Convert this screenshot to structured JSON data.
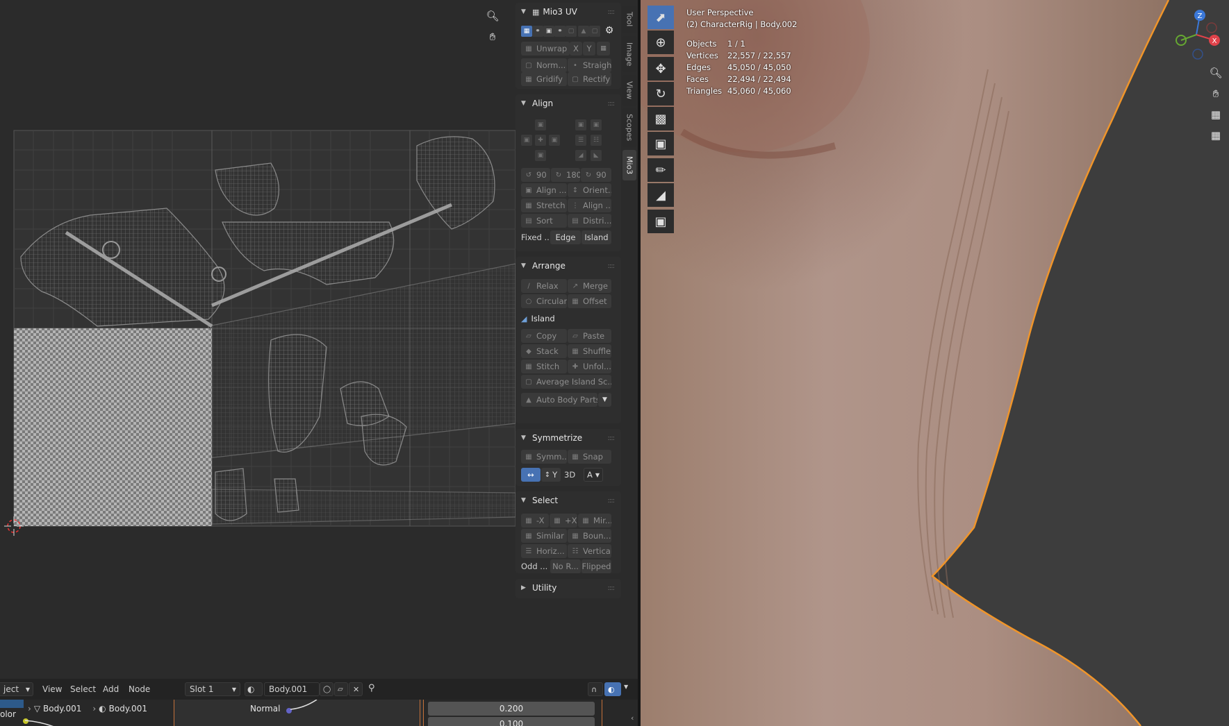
{
  "uv_editor": {
    "nav": {
      "zoom_icon": "zoom-in-icon",
      "pan_icon": "hand-pan-icon"
    }
  },
  "sidebar": {
    "tabs": [
      "Tool",
      "Image",
      "View",
      "Scopes",
      "Mio3"
    ],
    "active_tab": "Mio3",
    "mio3uv": {
      "title": "Mio3 UV",
      "unwrap": "Unwrap",
      "x": "X",
      "y": "Y",
      "norm": "Norm...",
      "straight": "Straight",
      "gridify": "Gridify",
      "rectify": "Rectify"
    },
    "align": {
      "title": "Align",
      "rot1": "90",
      "rot2": "180",
      "rot3": "90",
      "align_btn": "Align ...",
      "orient": "Orient...",
      "stretch": "Stretch",
      "align2": "Align ...",
      "sort": "Sort",
      "distri": "Distri...",
      "fixed": "Fixed ...",
      "edge": "Edge",
      "island": "Island"
    },
    "arrange": {
      "title": "Arrange",
      "relax": "Relax",
      "merge": "Merge",
      "circular": "Circular",
      "offset": "Offset",
      "island_label": "Island",
      "copy": "Copy",
      "paste": "Paste",
      "stack": "Stack",
      "shuffle": "Shuffle",
      "stitch": "Stitch",
      "unfol": "Unfol...",
      "average": "Average Island Sc...",
      "auto_body": "Auto Body Parts"
    },
    "symmetrize": {
      "title": "Symmetrize",
      "symm": "Symm...",
      "snap": "Snap",
      "y": "Y",
      "d3": "3D",
      "a": "A"
    },
    "select": {
      "title": "Select",
      "neg_x": "-X",
      "pos_x": "+X",
      "mir": "Mir...",
      "similar": "Similar",
      "boun": "Boun...",
      "horiz": "Horiz...",
      "vertical": "Vertical",
      "odd": "Odd ...",
      "nor": "No R...",
      "flipped": "Flipped"
    },
    "utility": {
      "title": "Utility"
    }
  },
  "node_editor": {
    "header": {
      "object_menu": "ject",
      "view": "View",
      "select": "Select",
      "add": "Add",
      "node": "Node",
      "slot": "Slot 1",
      "material": "Body.001"
    },
    "breadcrumb": {
      "left_label": "olor",
      "obj": "Body.001",
      "mat": "Body.001"
    },
    "node": {
      "socket_label": "Normal",
      "value1": "0.200",
      "value2": "0.100"
    }
  },
  "viewport": {
    "perspective": "User Perspective",
    "object_line": "(2) CharacterRig | Body.002",
    "stats": [
      {
        "label": "Objects",
        "value": "1 / 1"
      },
      {
        "label": "Vertices",
        "value": "22,557 / 22,557"
      },
      {
        "label": "Edges",
        "value": "45,050 / 45,050"
      },
      {
        "label": "Faces",
        "value": "22,494 / 22,494"
      },
      {
        "label": "Triangles",
        "value": "45,060 / 45,060"
      }
    ],
    "gizmo": {
      "z": "Z",
      "x": "X"
    },
    "accent_outline": "#f0952a",
    "active_tool_color": "#4772b3"
  }
}
